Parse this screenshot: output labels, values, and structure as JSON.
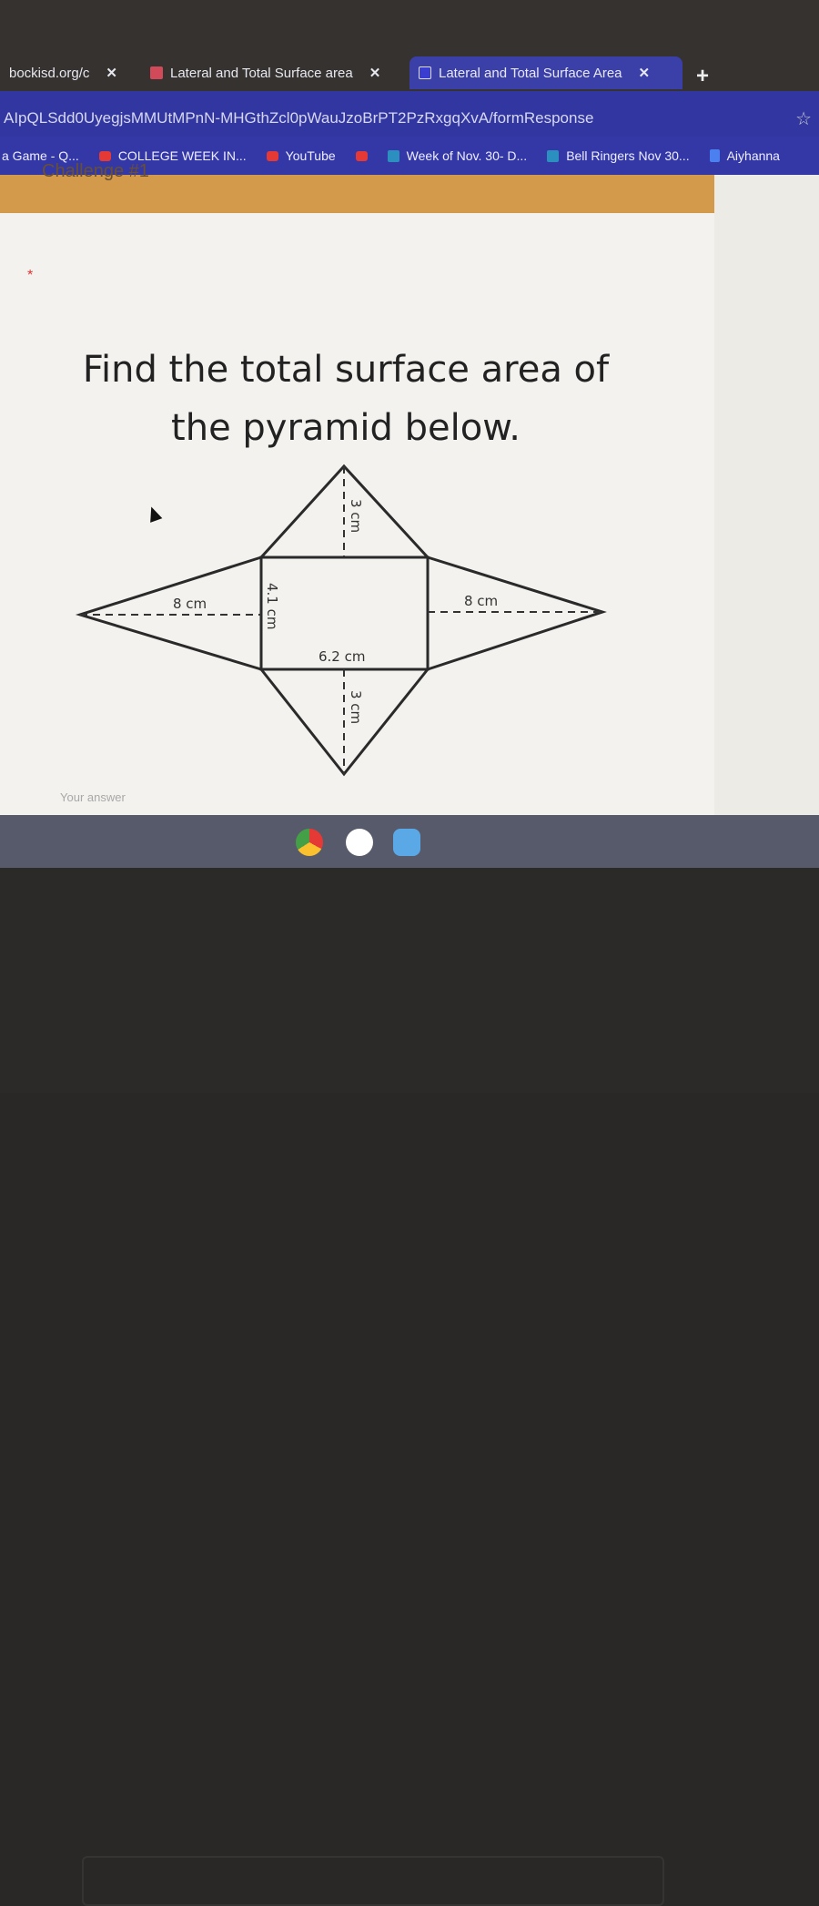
{
  "tabs": [
    {
      "label": "bockisd.org/c",
      "active": false,
      "icon": "none"
    },
    {
      "label": "Lateral and Total Surface area",
      "active": false,
      "icon": "classroom-icon"
    },
    {
      "label": "Lateral and Total Surface Area",
      "active": true,
      "icon": "forms-icon"
    }
  ],
  "omnibox": {
    "url": "AIpQLSdd0UyegjsMMUtMPnN-MHGthZcl0pWauJzoBrPT2PzRxgqXvA/formResponse"
  },
  "bookmarks": [
    {
      "label": "a Game - Q...",
      "icon": "none"
    },
    {
      "label": "COLLEGE WEEK IN...",
      "icon": "youtube-icon"
    },
    {
      "label": "YouTube",
      "icon": "youtube-icon"
    },
    {
      "label": "",
      "icon": "youtube-icon"
    },
    {
      "label": "Week of Nov. 30- D...",
      "icon": "classroom-icon"
    },
    {
      "label": "Bell Ringers Nov 30...",
      "icon": "classroom-icon"
    },
    {
      "label": "Aiyhanna",
      "icon": "docs-icon"
    }
  ],
  "form": {
    "section_title": "Challenge #1",
    "required_mark": "*",
    "question_line1": "Find the total surface area of",
    "question_line2": "the pyramid below.",
    "answer_placeholder": "Your answer"
  },
  "figure": {
    "top_height": "3 cm",
    "bottom_height": "3 cm",
    "left_height": "8 cm",
    "right_height": "8 cm",
    "base_width": "6.2 cm",
    "base_height": "4.1 cm"
  },
  "colors": {
    "accent": "#3438a6",
    "banner": "#d39a4c"
  }
}
